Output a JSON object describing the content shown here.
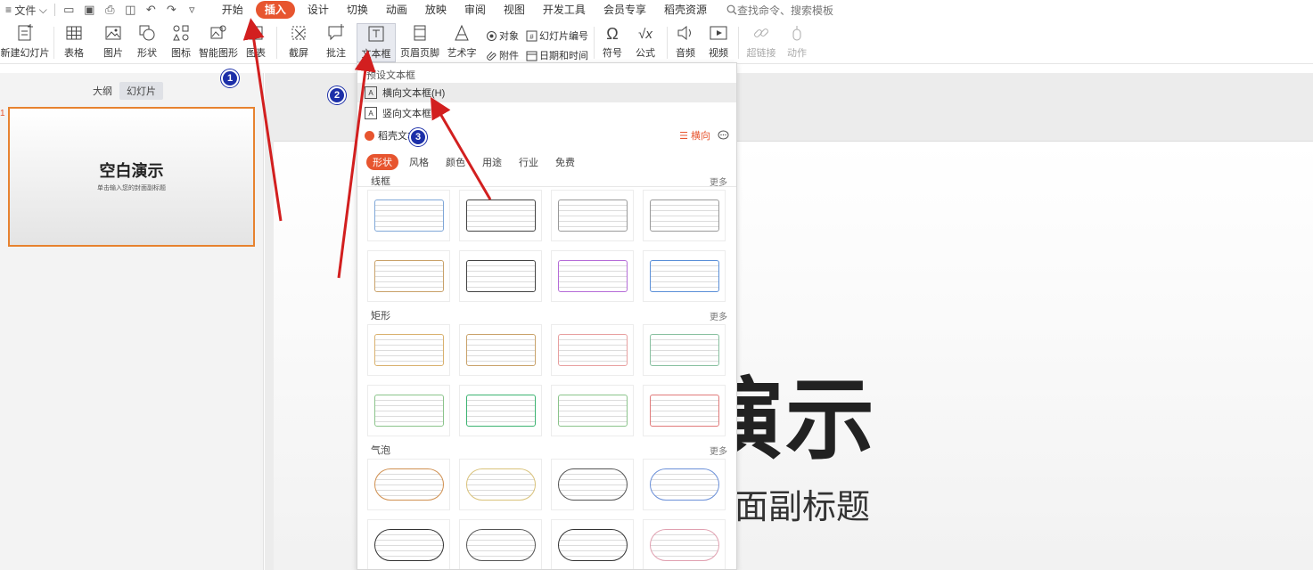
{
  "menubar": {
    "file_label": "文件",
    "tabs": [
      "开始",
      "插入",
      "设计",
      "切换",
      "动画",
      "放映",
      "审阅",
      "视图",
      "开发工具",
      "会员专享",
      "稻壳资源"
    ],
    "active_tab": "插入",
    "search_placeholder": "查找命令、搜索模板"
  },
  "ribbon": {
    "new_slide": "新建幻灯片",
    "table": "表格",
    "picture": "图片",
    "shape": "形状",
    "icon": "图标",
    "smart_shape": "智能图形",
    "chart": "图表",
    "screenshot": "截屏",
    "comment": "批注",
    "textbox": "文本框",
    "header_footer": "页眉页脚",
    "wordart": "艺术字",
    "object": "对象",
    "attachment": "附件",
    "slide_number": "幻灯片编号",
    "datetime": "日期和时间",
    "symbol": "符号",
    "formula": "公式",
    "audio": "音频",
    "video": "视频",
    "hyperlink": "超链接",
    "action": "动作"
  },
  "leftpanel": {
    "tab_outline": "大纲",
    "tab_slides": "幻灯片",
    "slide_number": "1",
    "thumb_title": "空白演示",
    "thumb_subtitle": "单击输入您的封面副标题"
  },
  "slide": {
    "title": "空白演示",
    "subtitle": "单击输入您的封面副标题"
  },
  "dropdown": {
    "preset_header": "预设文本框",
    "horizontal": "横向文本框(H)",
    "vertical": "竖向文本框",
    "shell_text": "稻壳文本框",
    "orientation": "横向",
    "filters": [
      "形状",
      "风格",
      "颜色",
      "用途",
      "行业",
      "免费"
    ],
    "active_filter": "形状",
    "sections": [
      {
        "label": "线框",
        "more": "更多"
      },
      {
        "label": "矩形",
        "more": "更多"
      },
      {
        "label": "气泡",
        "more": "更多"
      }
    ]
  },
  "annotations": {
    "badges": [
      "1",
      "2",
      "3"
    ],
    "color": "#1c2fa8",
    "arrow_color": "#d21f1f"
  },
  "colors": {
    "accent": "#e7552f",
    "thumb_border": "#e7822f"
  }
}
